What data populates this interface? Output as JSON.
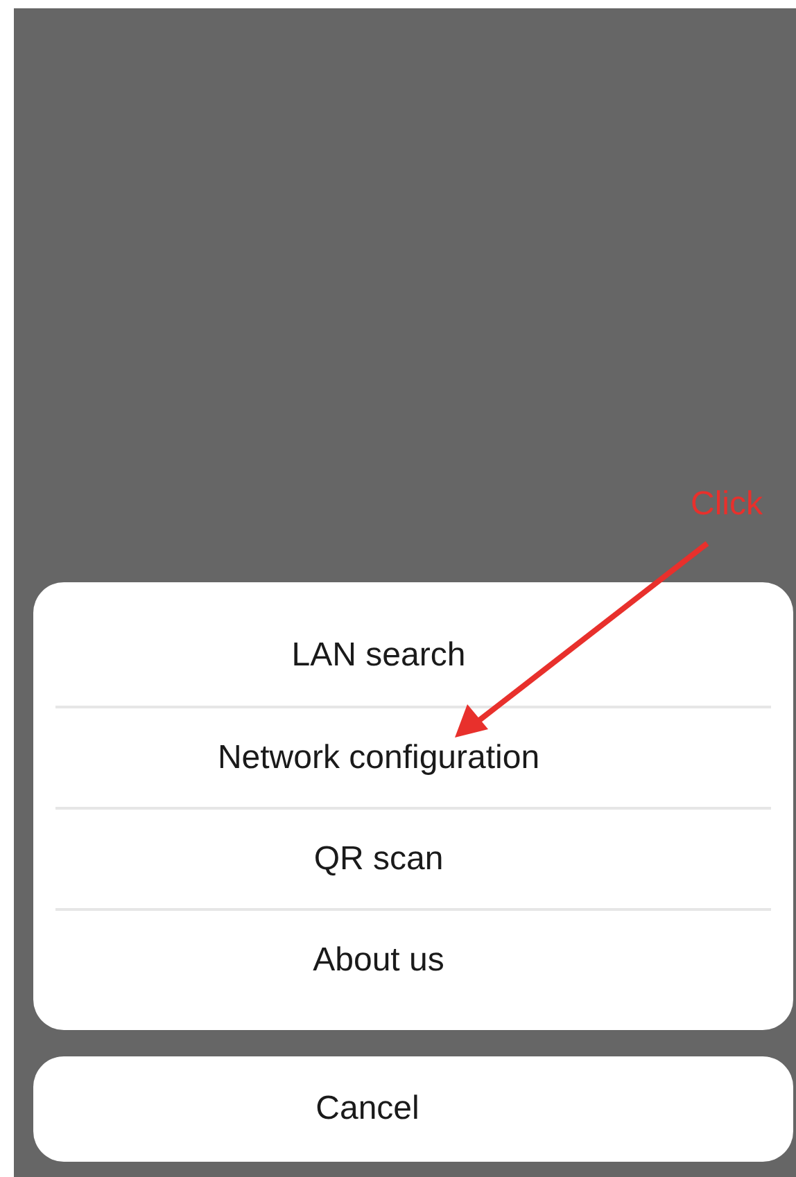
{
  "action_sheet": {
    "items": [
      {
        "label": "LAN search"
      },
      {
        "label": "Network configuration"
      },
      {
        "label": "QR scan"
      },
      {
        "label": "About us"
      }
    ]
  },
  "cancel_button": {
    "label": "Cancel"
  },
  "annotation": {
    "label": "Click"
  }
}
